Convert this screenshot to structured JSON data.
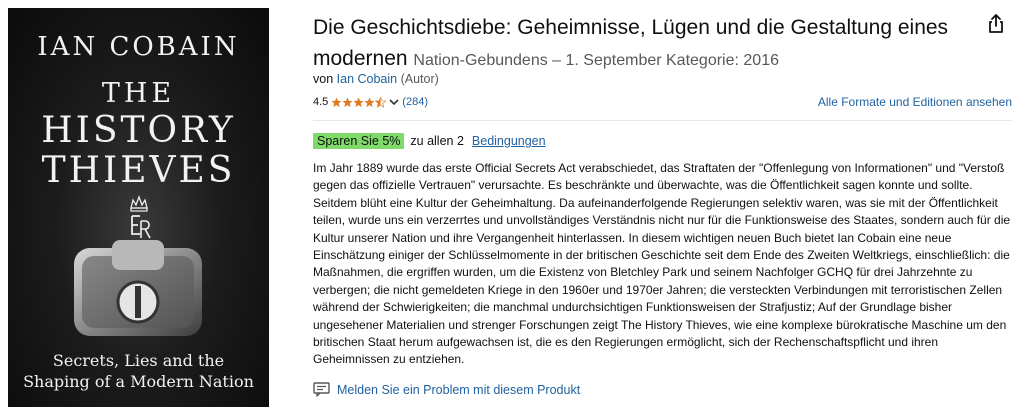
{
  "cover": {
    "author": "IAN COBAIN",
    "title_line1": "THE",
    "title_line2": "HISTORY",
    "title_line3": "THIEVES",
    "subtitle_line1": "Secrets, Lies and the",
    "subtitle_line2": "Shaping of a Modern Nation"
  },
  "product": {
    "title": "Die Geschichtsdiebe: Geheimnisse, Lügen und die Gestaltung eines modernen",
    "binding": "Nation-Gebundens – 1. September Kategorie: 2016",
    "by_prefix": "von",
    "author_name": "Ian Cobain",
    "author_role": "(Autor)",
    "rating_value": "4.5",
    "rating_stars": 4.5,
    "rating_count": "(284)",
    "all_formats": "Alle Formate und Editionen ansehen"
  },
  "promo": {
    "badge": "Sparen Sie 5%",
    "text": "zu allen 2",
    "link": "Bedingungen"
  },
  "description": "Im Jahr 1889 wurde das erste Official Secrets Act verabschiedet, das Straftaten der \"Offenlegung von Informationen\" und \"Verstoß gegen das offizielle Vertrauen\" verursachte. Es beschränkte und überwachte, was die Öffentlichkeit sagen konnte und sollte. Seitdem blüht eine Kultur der Geheimhaltung. Da aufeinanderfolgende Regierungen selektiv waren, was sie mit der Öffentlichkeit teilen, wurde uns ein verzerrtes und unvollständiges Verständnis nicht nur für die Funktionsweise des Staates, sondern auch für die Kultur unserer Nation und ihre Vergangenheit hinterlassen. In diesem wichtigen neuen Buch bietet Ian Cobain eine neue Einschätzung einiger der Schlüsselmomente in der britischen Geschichte seit dem Ende des Zweiten Weltkriegs, einschließlich: die Maßnahmen, die ergriffen wurden, um die Existenz von Bletchley Park und seinem Nachfolger GCHQ für drei Jahrzehnte zu verbergen; die nicht gemeldeten Kriege in den 1960er und 1970er Jahren; die versteckten Verbindungen mit terroristischen Zellen während der Schwierigkeiten; die manchmal undurchsichtigen Funktionsweisen der Strafjustiz; Auf der Grundlage bisher ungesehener Materialien und strenger Forschungen zeigt The History Thieves, wie eine komplexe bürokratische Maschine um den britischen Staat herum aufgewachsen ist, die es den Regierungen ermöglicht, sich der Rechenschaftspflicht und ihren Geheimnissen zu entziehen.",
  "report": "Melden Sie ein Problem mit diesem Produkt",
  "colors": {
    "link": "#2162a1",
    "star": "#de7921",
    "badge": "#7fda69"
  }
}
